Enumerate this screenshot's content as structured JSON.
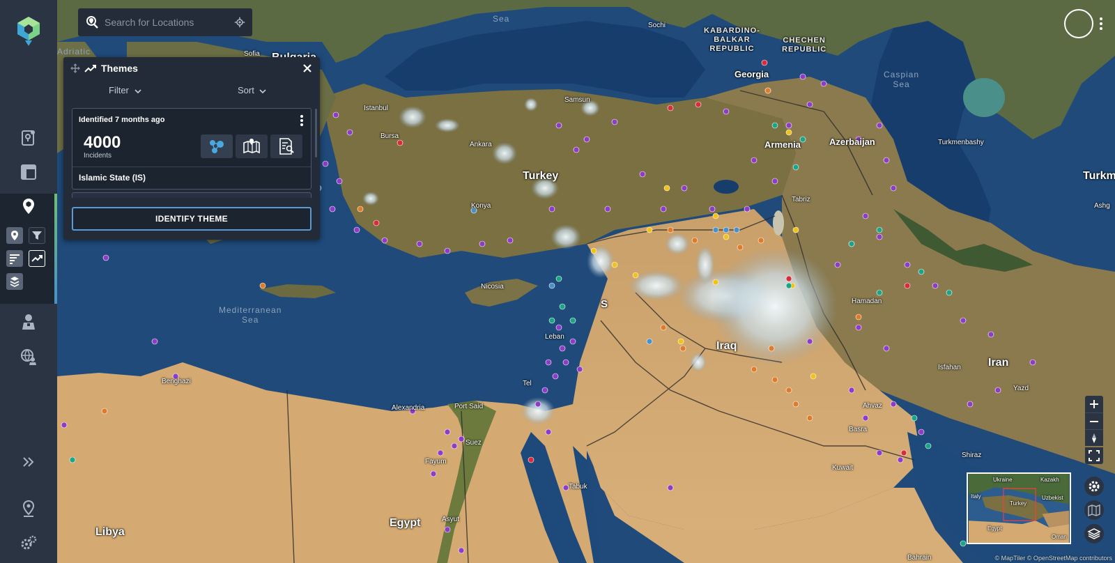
{
  "search": {
    "placeholder": "Search for Locations"
  },
  "themes_panel": {
    "title": "Themes",
    "filter_label": "Filter",
    "sort_label": "Sort",
    "card": {
      "identified_text": "Identified 7 months ago",
      "count": "4000",
      "count_label": "Incidents",
      "group_name": "Islamic State (IS)"
    },
    "identify_button": "IDENTIFY THEME"
  },
  "map_labels": {
    "seas": {
      "black_sea": "Sea",
      "caspian": "Caspian\nSea",
      "mediterranean": "Mediterranean\nSea"
    },
    "countries": {
      "turkey": "Turkey",
      "georgia": "Georgia",
      "armenia": "Armenia",
      "azerbaijan": "Azerbaijan",
      "iraq": "Iraq",
      "iran": "Iran",
      "egypt": "Egypt",
      "libya": "Libya",
      "bulgaria": "Bulgaria",
      "turkmen": "Turkm",
      "kabardino": "KABARDINO-\nBALKAR\nREPUBLIC",
      "chechen": "CHECHEN\nREPUBLIC"
    },
    "cities": {
      "sochi": "Sochi",
      "sofia": "Sofia",
      "istanbul": "Istanbul",
      "bursa": "Bursa",
      "ankara": "Ankara",
      "samsun": "Samsun",
      "konya": "Konya",
      "tabriz": "Tabriz",
      "nicosia": "Nicosia",
      "hamadan": "Hamadan",
      "turkmenbashy": "Turkmenbashy",
      "ashgabat": "Ashg",
      "benghazi": "Benghazi",
      "alexandria": "Alexandria",
      "port_said": "Port Said",
      "suez": "Suez",
      "fayum": "Fayum",
      "asyut": "Asyut",
      "tabuk": "Tabuk",
      "kuwait": "Kuwait",
      "bahrain": "Bahrain",
      "yazd": "Yazd",
      "isfahan": "Isfahan",
      "shiraz": "Shiraz",
      "ahvaz": "Ahvaz",
      "basra": "Basra",
      "adriatic": "Adriatic",
      "lebanon": "Leban",
      "tel_aviv": "Tel",
      "syria_s": "S"
    }
  },
  "minimap": {
    "labels": [
      "Ukraine",
      "Kazakh",
      "Italy",
      "Turkey",
      "Uzbekist",
      "Egypt",
      "Oman"
    ]
  },
  "attribution": "© MapTiler © OpenStreetMap contributors",
  "colors": {
    "sidebar": "#2b3442",
    "panel": "#222b37",
    "accent_blue": "#5b9bd5",
    "accent_green": "#6fbf73",
    "marker_purple": "#8e3cc7",
    "marker_orange": "#e07b2a",
    "marker_yellow": "#f2c21a",
    "marker_teal": "#1aa588",
    "marker_red": "#d92b3a"
  }
}
